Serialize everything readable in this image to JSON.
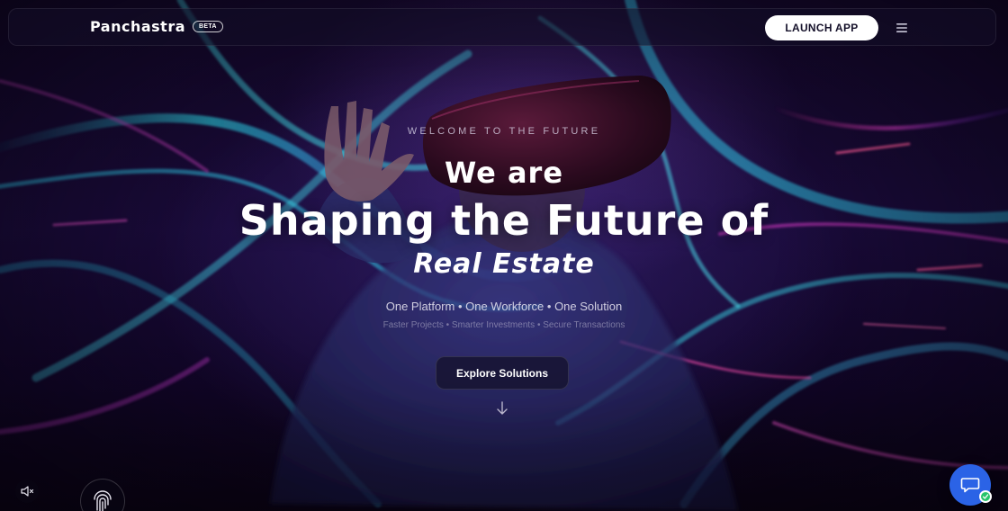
{
  "header": {
    "brand_name": "Panchastra",
    "beta_label": "BETA",
    "launch_label": "LAUNCH APP",
    "menu_icon": "menu-icon"
  },
  "hero": {
    "eyebrow": "WELCOME TO THE FUTURE",
    "line1": "We are",
    "line2": "Shaping the Future of",
    "line3": "Real Estate",
    "tagline": "One Platform • One Workforce • One Solution",
    "subtagline": "Faster Projects • Smarter Investments • Secure Transactions",
    "cta_label": "Explore Solutions",
    "scroll_icon": "arrow-down-icon"
  },
  "controls": {
    "mute_icon": "speaker-muted-icon",
    "fingerprint_icon": "fingerprint-icon",
    "chat_icon": "chat-bubble-icon",
    "chat_status_icon": "online-status-icon"
  },
  "colors": {
    "accent_blue": "#2b63e6",
    "status_green": "#27c46b",
    "cyan_light": "#3fd6e6",
    "magenta_light": "#c23cb8",
    "background": "#14082a"
  }
}
